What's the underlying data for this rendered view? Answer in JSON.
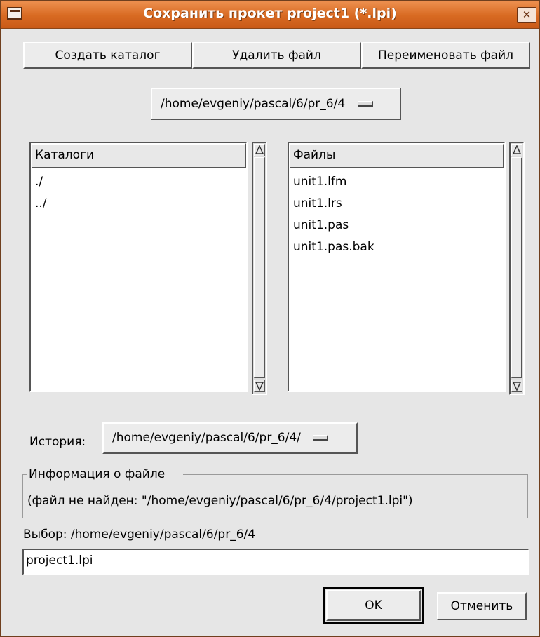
{
  "window": {
    "title": "Сохранить прокет project1 (*.lpi)",
    "close_glyph": "✕",
    "icons": [
      "window-menu-icon",
      "close-icon",
      "scroll-up-arrow-icon",
      "scroll-down-arrow-icon",
      "combo-indicator-icon"
    ]
  },
  "toolbar": {
    "create_dir": "Создать каталог",
    "delete_file": "Удалить файл",
    "rename_file": "Переименовать файл"
  },
  "path_combo": {
    "value": "/home/evgeniy/pascal/6/pr_6/4"
  },
  "dirs": {
    "header": "Каталоги",
    "items": [
      "./",
      "../"
    ]
  },
  "files": {
    "header": "Файлы",
    "items": [
      "unit1.lfm",
      "unit1.lrs",
      "unit1.pas",
      "unit1.pas.bak"
    ]
  },
  "history": {
    "label": "История:",
    "value": "/home/evgeniy/pascal/6/pr_6/4/"
  },
  "file_info": {
    "legend": "Информация о файле",
    "text": "(файл не найден: \"/home/evgeniy/pascal/6/pr_6/4/project1.lpi\")"
  },
  "selection": {
    "label": "Выбор: /home/evgeniy/pascal/6/pr_6/4",
    "value": "project1.lpi"
  },
  "buttons": {
    "ok": "OK",
    "cancel": "Отменить"
  },
  "colors": {
    "titlebar": "#d86a22",
    "window_bg": "#e6e6e6"
  }
}
